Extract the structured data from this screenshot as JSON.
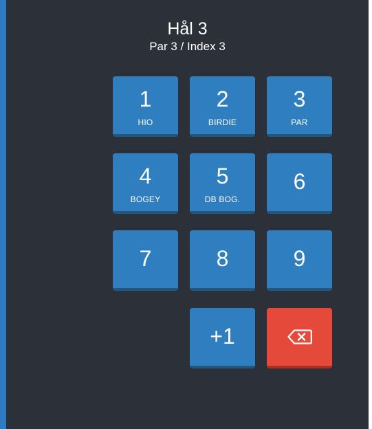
{
  "hole": {
    "title": "Hål 3",
    "subtitle": "Par 3 / Index 3"
  },
  "keypad": {
    "keys": [
      {
        "number": "1",
        "label": "HIO"
      },
      {
        "number": "2",
        "label": "BIRDIE"
      },
      {
        "number": "3",
        "label": "PAR"
      },
      {
        "number": "4",
        "label": "BOGEY"
      },
      {
        "number": "5",
        "label": "DB BOG."
      },
      {
        "number": "6",
        "label": ""
      },
      {
        "number": "7",
        "label": ""
      },
      {
        "number": "8",
        "label": ""
      },
      {
        "number": "9",
        "label": ""
      },
      {
        "number": "+1",
        "label": ""
      }
    ],
    "delete_icon": "backspace-icon"
  },
  "colors": {
    "background": "#2c3038",
    "key": "#2f7fc0",
    "delete_key": "#e5493a",
    "accent_edge": "#2e7bc4"
  }
}
